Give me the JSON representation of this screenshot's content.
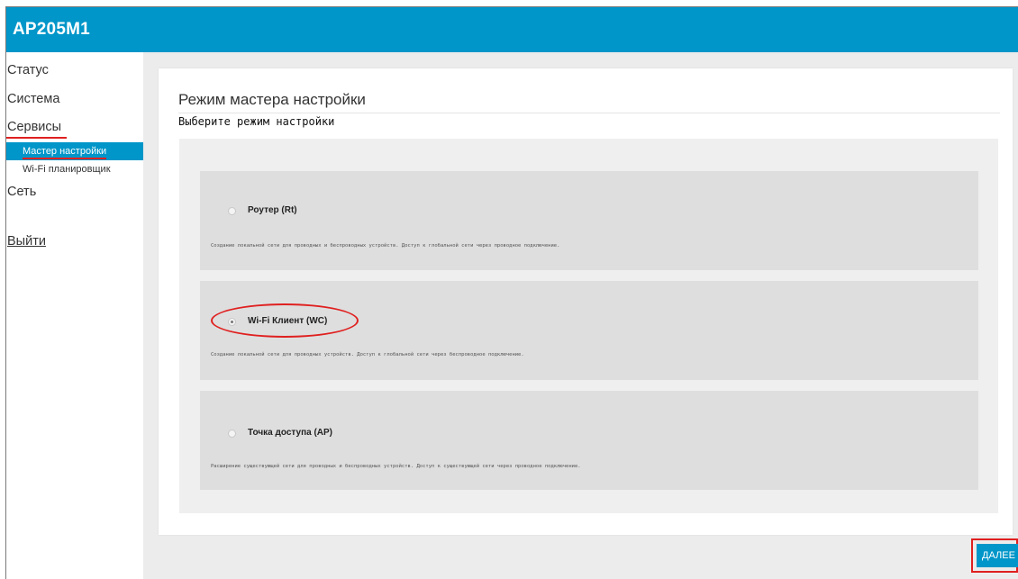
{
  "header": {
    "title": "AP205M1"
  },
  "sidebar": {
    "items": [
      {
        "label": "Статус"
      },
      {
        "label": "Система"
      },
      {
        "label": "Сервисы"
      },
      {
        "label": "Сеть"
      },
      {
        "label": "Выйти"
      }
    ],
    "subitems": [
      {
        "label": "Мастер настройки",
        "active": true
      },
      {
        "label": "Wi-Fi планировщик",
        "active": false
      }
    ]
  },
  "main": {
    "page_title": "Режим мастера настройки",
    "subtitle": "Выберите режим настройки",
    "options": [
      {
        "label": "Роутер (Rt)",
        "description": "Создание локальной сети для проводных и беспроводных устройств. Доступ к глобальной сети через проводное подключение.",
        "selected": false
      },
      {
        "label": "Wi-Fi Клиент (WC)",
        "description": "Создание локальной сети для проводных устройств. Доступ к глобальной сети через беспроводное подключение.",
        "selected": true
      },
      {
        "label": "Точка доступа (AP)",
        "description": "Расширение существующей сети для проводных и беспроводных устройств. Доступ к существующей сети через проводное подключение.",
        "selected": false
      }
    ],
    "next_label": "ДАЛЕЕ"
  },
  "colors": {
    "accent": "#0096c9",
    "annotation": "#e02020"
  }
}
